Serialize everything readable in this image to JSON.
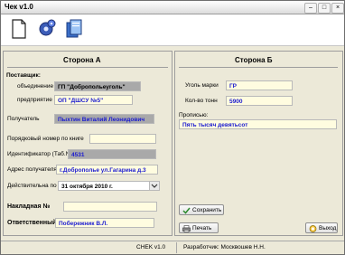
{
  "window": {
    "title": "Чек v1.0"
  },
  "toolbar": {
    "items": [
      "new-document-icon",
      "settings-gears-icon",
      "pages-icon"
    ]
  },
  "side_a": {
    "title": "Сторона А",
    "supplier_label": "Поставщик:",
    "association_label": "объединение",
    "association_value": "ГП \"Добропольеуголь\"",
    "enterprise_label": "предприятие",
    "enterprise_value": "ОП \"ДШСУ №5\"",
    "recipient_label": "Получатель",
    "recipient_value": "Пыхтин Виталий Леонидович",
    "order_label": "Порядковый номер по книге",
    "order_value": "",
    "id_label": "Идентификатор (Таб.N°)",
    "id_value": "4531",
    "address_label": "Адрес получателя",
    "address_value": "г.Доброполье ул.Гагарина д.3",
    "valid_label": "Действительна по",
    "valid_value": "31  октября  2010 г.",
    "invoice_label": "Накладная №",
    "invoice_value": "",
    "responsible_label": "Ответственный",
    "responsible_value": "Побережник В.Л."
  },
  "side_b": {
    "title": "Сторона Б",
    "coal_label": "Уголь марки",
    "coal_value": "ГР",
    "tons_label": "Кол-во тонн",
    "tons_value": "5900",
    "words_label": "Прописью:",
    "words_value": "Пять тысяч девятьсот"
  },
  "buttons": {
    "save": "Сохранить",
    "print": "Печать",
    "exit": "Выход"
  },
  "status": {
    "app": "CHEK v1.0",
    "developer": "Разработчик: Москвошев Н.Н."
  }
}
